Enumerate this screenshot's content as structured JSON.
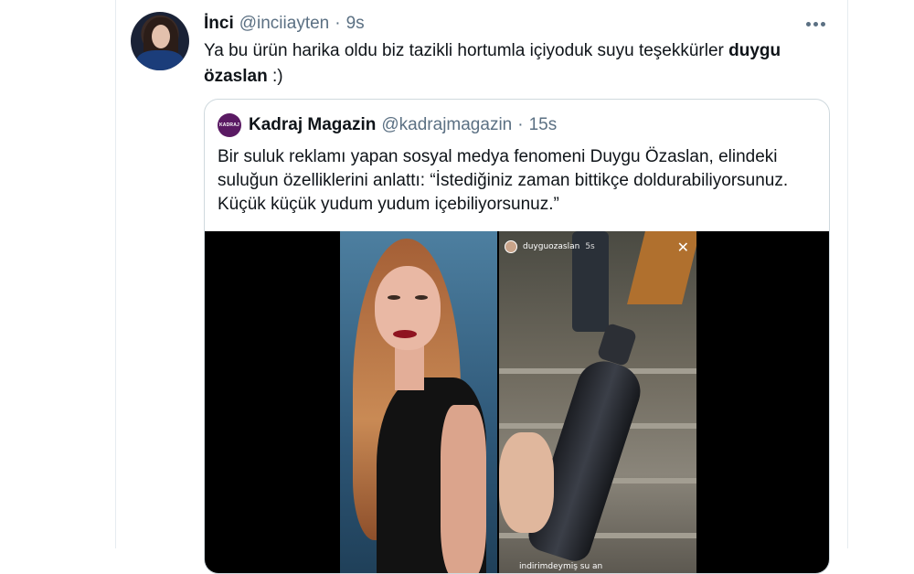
{
  "tweet": {
    "display_name": "İnci",
    "handle": "@inciiayten",
    "separator": "·",
    "time": "9s",
    "text_before": "Ya bu ürün harika oldu biz tazikli hortumla içiyoduk suyu teşekkürler ",
    "mention": "duygu özaslan",
    "text_after": " :)",
    "more_icon": "more-horizontal-icon"
  },
  "quote": {
    "avatar_text": "KADRAJ",
    "display_name": "Kadraj Magazin",
    "handle": "@kadrajmagazin",
    "separator": "·",
    "time": "15s",
    "text": "Bir suluk reklamı yapan sosyal medya fenomeni Duygu Özaslan, elindeki suluğun özelliklerini anlattı: “İstediğiniz zaman bittikçe doldurabiliyorsunuz. Küçük küçük yudum yudum içebiliyorsunuz.”",
    "media": {
      "story_username": "duyguozaslan",
      "story_time": "5s",
      "story_close": "✕",
      "story_caption": "indirimdeymiş su an"
    }
  },
  "colors": {
    "text_primary": "#0f1419",
    "text_secondary": "#5b7083",
    "border": "#cfd9de",
    "quote_avatar_bg": "#5a1a63"
  }
}
